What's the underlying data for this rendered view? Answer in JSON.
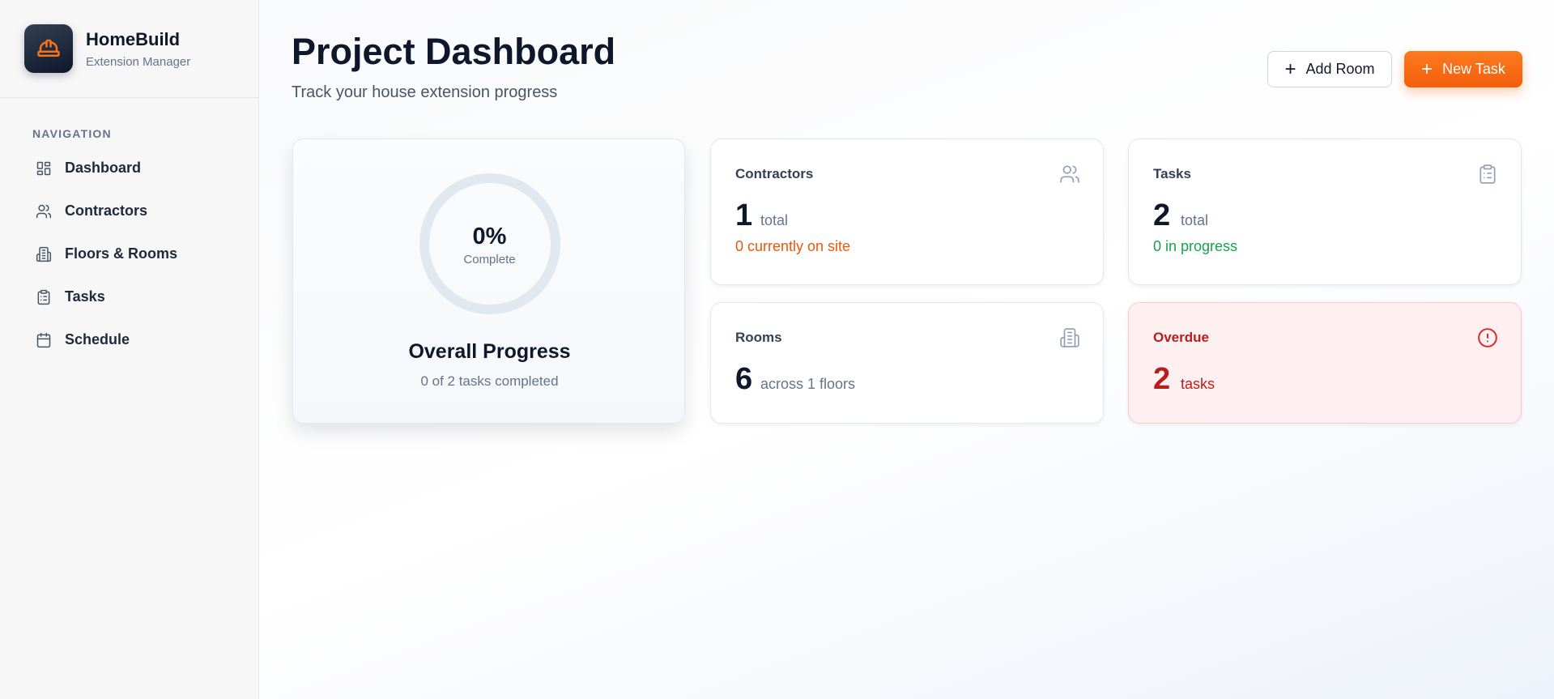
{
  "brand": {
    "name": "HomeBuild",
    "subtitle": "Extension Manager",
    "logo_icon": "hard-hat-icon",
    "accent": "#f97316"
  },
  "nav": {
    "heading": "NAVIGATION",
    "items": [
      {
        "label": "Dashboard",
        "icon": "grid-icon"
      },
      {
        "label": "Contractors",
        "icon": "users-icon"
      },
      {
        "label": "Floors & Rooms",
        "icon": "building-icon"
      },
      {
        "label": "Tasks",
        "icon": "clipboard-icon"
      },
      {
        "label": "Schedule",
        "icon": "calendar-icon"
      }
    ]
  },
  "header": {
    "title": "Project Dashboard",
    "subtitle": "Track your house extension progress",
    "add_room_label": "Add Room",
    "new_task_label": "New Task"
  },
  "progress": {
    "percent_text": "0%",
    "percent_value": 0,
    "complete_label": "Complete",
    "title": "Overall Progress",
    "summary": "0 of 2 tasks completed"
  },
  "stats": {
    "contractors": {
      "title": "Contractors",
      "value": "1",
      "unit": "total",
      "note": "0 currently on site",
      "note_color": "#ea580c",
      "icon": "users-icon"
    },
    "tasks": {
      "title": "Tasks",
      "value": "2",
      "unit": "total",
      "note": "0 in progress",
      "note_color": "#16a34a",
      "icon": "clipboard-icon"
    },
    "rooms": {
      "title": "Rooms",
      "value": "6",
      "unit": "across 1 floors",
      "icon": "building-icon"
    },
    "overdue": {
      "title": "Overdue",
      "value": "2",
      "unit": "tasks",
      "color": "#b91c1c",
      "icon": "alert-circle-icon"
    }
  }
}
